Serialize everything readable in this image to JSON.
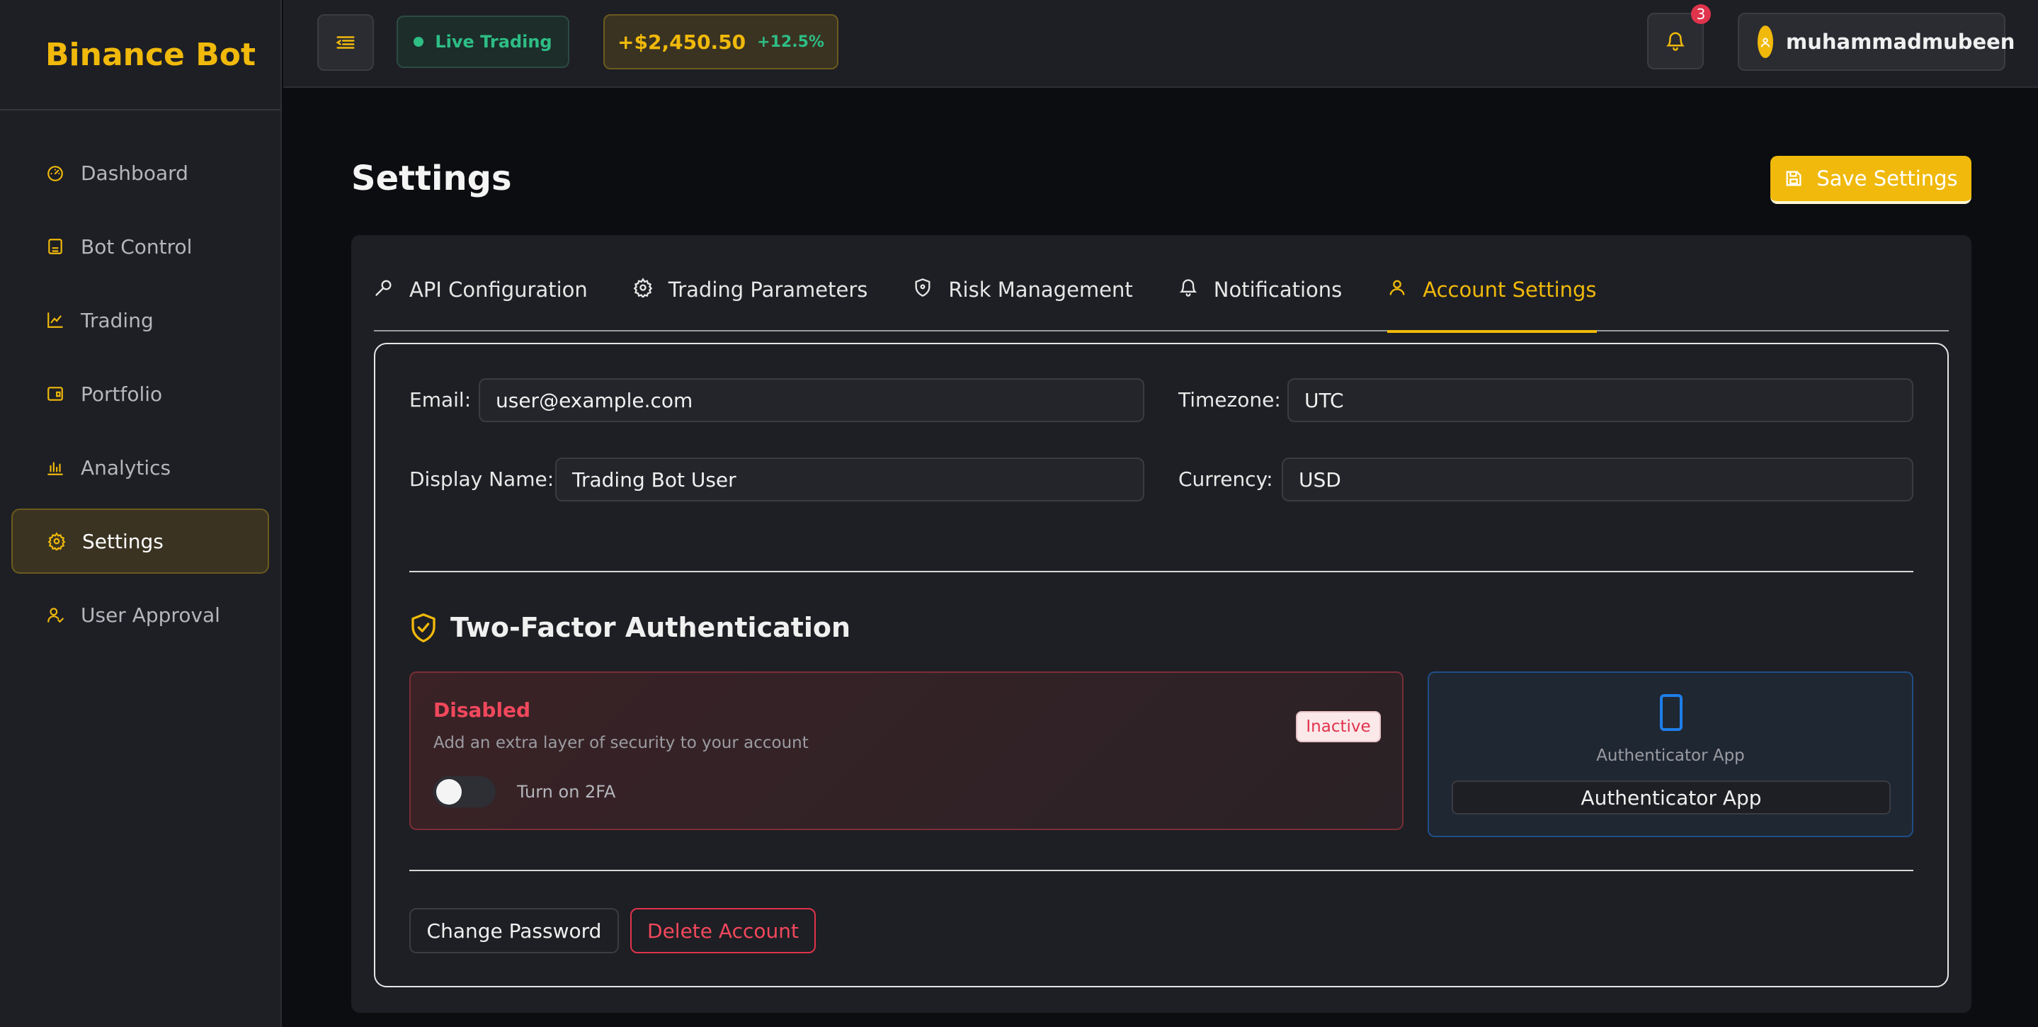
{
  "brand": {
    "name": "Binance Bot"
  },
  "sidebar": {
    "items": [
      {
        "label": "Dashboard",
        "icon": "gauge-icon",
        "active": false
      },
      {
        "label": "Bot Control",
        "icon": "bot-icon",
        "active": false
      },
      {
        "label": "Trading",
        "icon": "line-chart-icon",
        "active": false
      },
      {
        "label": "Portfolio",
        "icon": "wallet-icon",
        "active": false
      },
      {
        "label": "Analytics",
        "icon": "bar-chart-icon",
        "active": false
      },
      {
        "label": "Settings",
        "icon": "gear-icon",
        "active": true
      },
      {
        "label": "User Approval",
        "icon": "user-check-icon",
        "active": false
      }
    ]
  },
  "topbar": {
    "live_label": "Live Trading",
    "pnl_value": "+$2,450.50",
    "pnl_percent": "+12.5%",
    "notification_count": "3",
    "username": "muhammadmubeen"
  },
  "page": {
    "title": "Settings",
    "save_label": "Save Settings"
  },
  "tabs": [
    {
      "label": "API Configuration",
      "icon": "key-icon",
      "active": false
    },
    {
      "label": "Trading Parameters",
      "icon": "gear-icon",
      "active": false
    },
    {
      "label": "Risk Management",
      "icon": "shield-icon",
      "active": false
    },
    {
      "label": "Notifications",
      "icon": "bell-icon",
      "active": false
    },
    {
      "label": "Account Settings",
      "icon": "user-icon",
      "active": true
    }
  ],
  "account": {
    "email_label": "Email",
    "email_value": "user@example.com",
    "timezone_label": "Timezone",
    "timezone_value": "UTC",
    "display_name_label": "Display Name",
    "display_name_value": "Trading Bot User",
    "currency_label": "Currency",
    "currency_value": "USD"
  },
  "twofa": {
    "title": "Two-Factor Authentication",
    "status_title": "Disabled",
    "status_subtitle": "Add an extra layer of security to your account",
    "toggle_label": "Turn on 2FA",
    "badge": "Inactive",
    "method_label": "Authenticator App",
    "method_button": "Authenticator App"
  },
  "actions": {
    "change_password": "Change Password",
    "delete_account": "Delete Account"
  },
  "colors": {
    "accent": "#f0b90b",
    "success": "#2ebd85",
    "danger": "#e0334c",
    "info": "#1e7ee8"
  }
}
